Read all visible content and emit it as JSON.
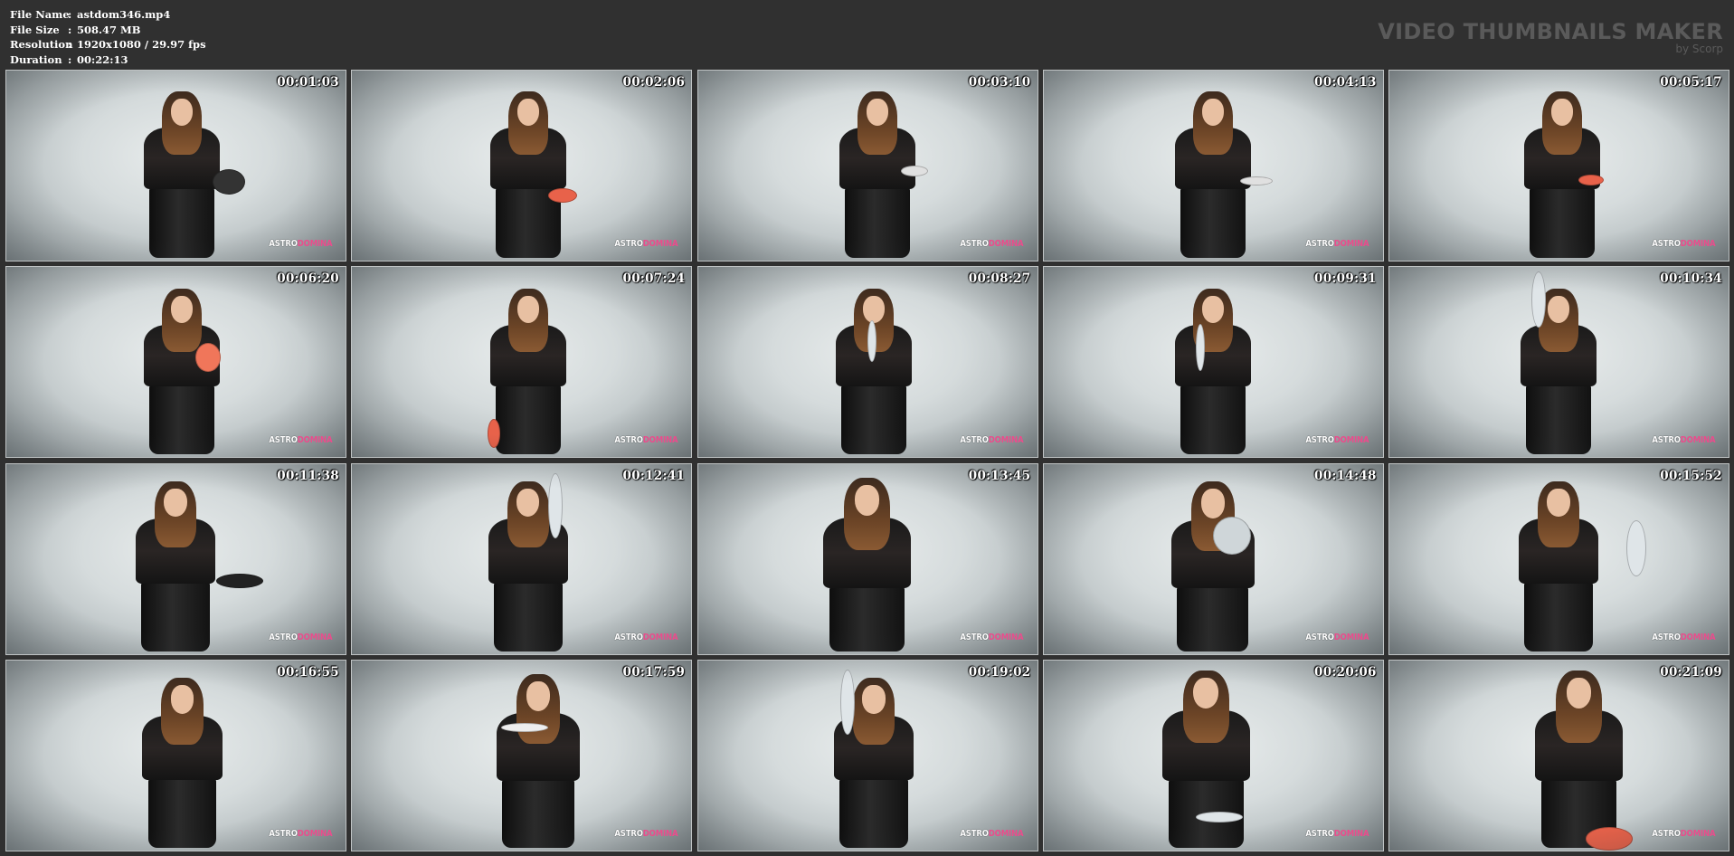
{
  "info": {
    "file_name_label": "File Name",
    "file_name": "astdom346.mp4",
    "file_size_label": "File Size",
    "file_size": "508.47 MB",
    "resolution_label": "Resolution",
    "resolution": "1920x1080 / 29.97 fps",
    "duration_label": "Duration",
    "duration": "00:22:13",
    "separator": ":"
  },
  "brand": {
    "title": "VIDEO THUMBNAILS MAKER",
    "subtitle": "by Scorp"
  },
  "watermark": {
    "part_a": "ASTRO",
    "part_b": "DOMINA",
    "color_b": "#ea4c8c"
  },
  "thumbnails": [
    {
      "timestamp": "00:01:03"
    },
    {
      "timestamp": "00:02:06"
    },
    {
      "timestamp": "00:03:10"
    },
    {
      "timestamp": "00:04:13"
    },
    {
      "timestamp": "00:05:17"
    },
    {
      "timestamp": "00:06:20"
    },
    {
      "timestamp": "00:07:24"
    },
    {
      "timestamp": "00:08:27"
    },
    {
      "timestamp": "00:09:31"
    },
    {
      "timestamp": "00:10:34"
    },
    {
      "timestamp": "00:11:38"
    },
    {
      "timestamp": "00:12:41"
    },
    {
      "timestamp": "00:13:45"
    },
    {
      "timestamp": "00:14:48"
    },
    {
      "timestamp": "00:15:52"
    },
    {
      "timestamp": "00:16:55"
    },
    {
      "timestamp": "00:17:59"
    },
    {
      "timestamp": "00:19:02"
    },
    {
      "timestamp": "00:20:06"
    },
    {
      "timestamp": "00:21:09"
    }
  ],
  "colors": {
    "background": "#303030",
    "thumb_border": "#bfc3c4",
    "brand": "#5a5a5a"
  }
}
